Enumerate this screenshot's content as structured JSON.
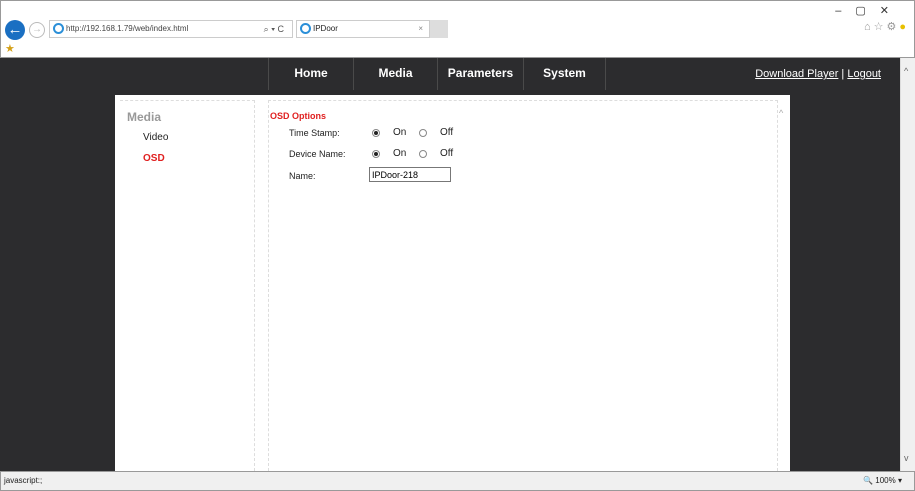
{
  "browser": {
    "url": "http://192.168.1.79/web/index.html",
    "tab_title": "IPDoor",
    "addr_tools": "⌕ ▾ C",
    "status_text": "javascript:;",
    "zoom": "100%"
  },
  "nav": {
    "items": [
      "Home",
      "Media",
      "Parameters",
      "System"
    ],
    "download": "Download Player",
    "sep": "|",
    "logout": "Logout"
  },
  "sidebar": {
    "heading": "Media",
    "items": [
      "Video",
      "OSD"
    ]
  },
  "osd": {
    "title": "OSD Options",
    "time_stamp_label": "Time Stamp:",
    "device_name_label": "Device Name:",
    "name_label": "Name:",
    "on": "On",
    "off": "Off",
    "time_stamp": "On",
    "device_name": "On",
    "name_value": "IPDoor-218"
  }
}
